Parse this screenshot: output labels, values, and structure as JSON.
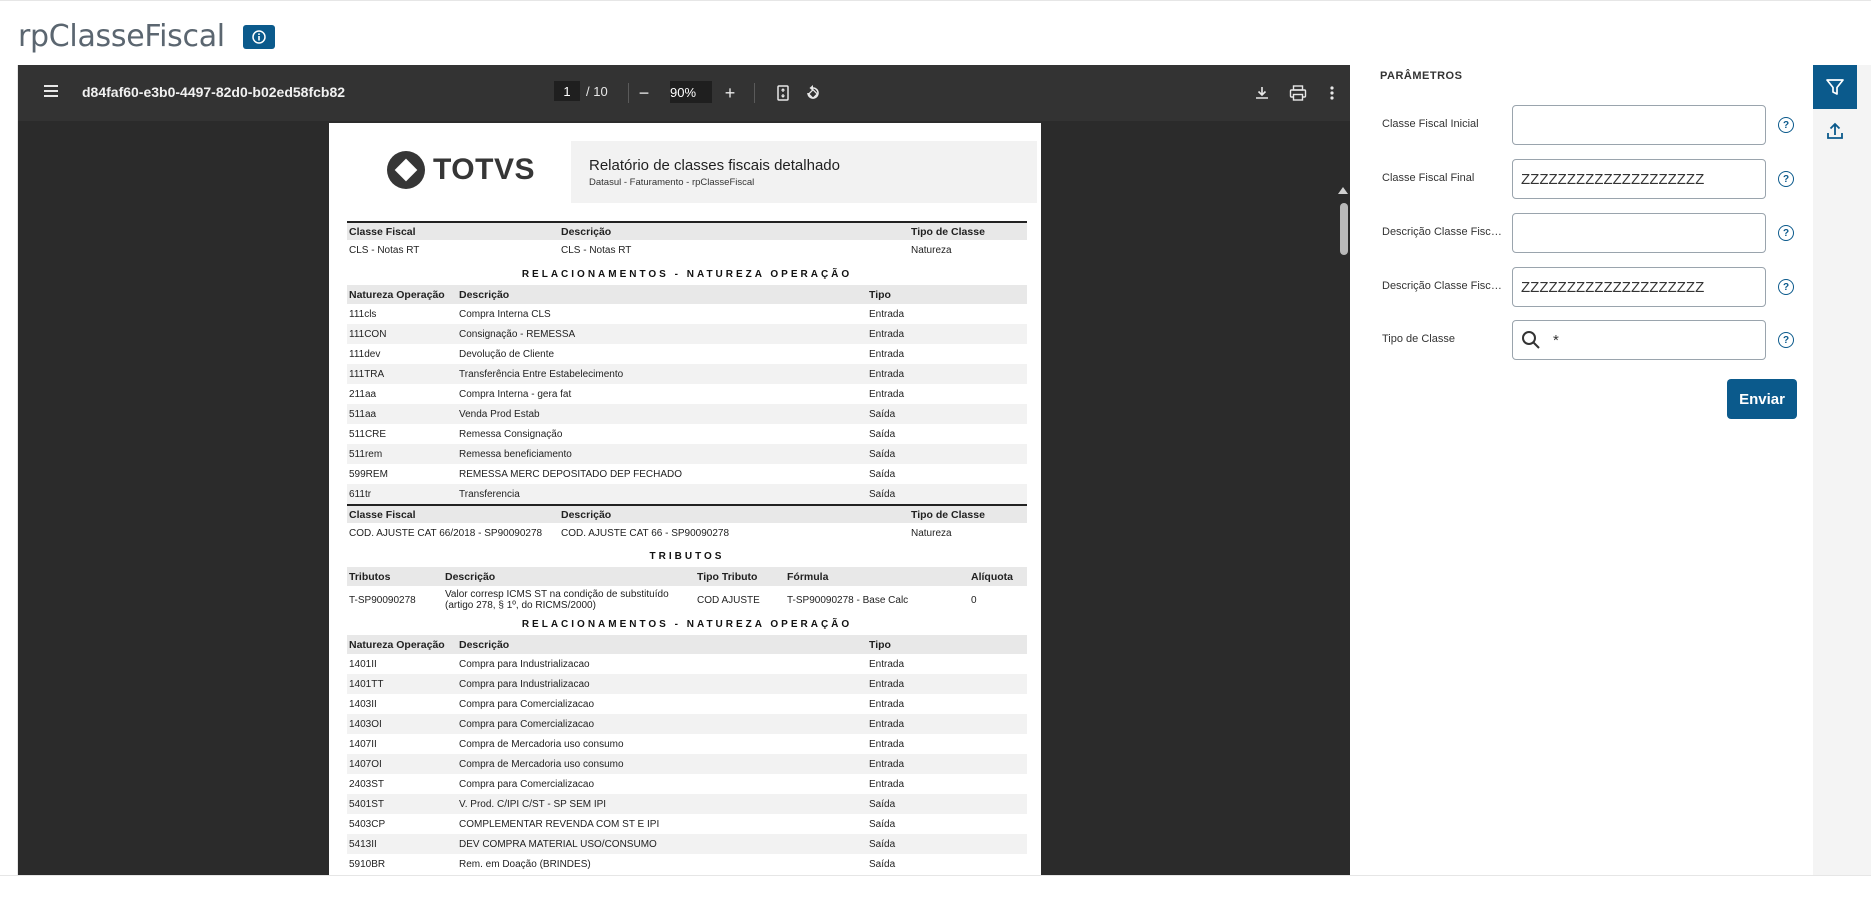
{
  "app": {
    "title": "rpClasseFiscal"
  },
  "viewer": {
    "file_name": "d84faf60-e3b0-4497-82d0-b02ed58fcb82",
    "current_page": "1",
    "page_total": "/ 10",
    "zoom": "90%",
    "zoom_out": "−",
    "zoom_in": "+"
  },
  "report": {
    "logo_text": "TOTVS",
    "title": "Relatório de classes fiscais detalhado",
    "subtitle": "Datasul - Faturamento - rpClasseFiscal",
    "class_headers": [
      "Classe Fiscal",
      "Descrição",
      "Tipo de Classe"
    ],
    "nat_headers": [
      "Natureza Operação",
      "Descrição",
      "Tipo"
    ],
    "trib_headers": [
      "Tributos",
      "Descrição",
      "Tipo Tributo",
      "Fórmula",
      "Alíquota"
    ],
    "section_nat": "RELACIONAMENTOS - NATUREZA OPERAÇÃO",
    "section_trib": "TRIBUTOS",
    "class1": [
      "CLS - Notas RT",
      "CLS - Notas RT",
      "Natureza"
    ],
    "nat1": [
      [
        "111cls",
        "Compra Interna CLS",
        "Entrada"
      ],
      [
        "111CON",
        "Consignação - REMESSA",
        "Entrada"
      ],
      [
        "111dev",
        "Devolução de Cliente",
        "Entrada"
      ],
      [
        "111TRA",
        "Transferência Entre Estabelecimento",
        "Entrada"
      ],
      [
        "211aa",
        "Compra Interna - gera fat",
        "Entrada"
      ],
      [
        "511aa",
        "Venda Prod Estab",
        "Saída"
      ],
      [
        "511CRE",
        "Remessa Consignação",
        "Saída"
      ],
      [
        "511rem",
        "Remessa beneficiamento",
        "Saída"
      ],
      [
        "599REM",
        "REMESSA MERC DEPOSITADO DEP FECHADO",
        "Saída"
      ],
      [
        "611tr",
        "Transferencia",
        "Saída"
      ]
    ],
    "class2": [
      "COD. AJUSTE CAT 66/2018 - SP90090278",
      "COD. AJUSTE CAT 66 - SP90090278",
      "Natureza"
    ],
    "trib1": [
      "T-SP90090278",
      "Valor corresp ICMS ST na condição de substituído (artigo 278, § 1º, do RICMS/2000)",
      "COD AJUSTE",
      "T-SP90090278 - Base Calc",
      "0"
    ],
    "nat2": [
      [
        "1401II",
        "Compra para Industrializacao",
        "Entrada"
      ],
      [
        "1401TT",
        "Compra para Industrializacao",
        "Entrada"
      ],
      [
        "1403II",
        "Compra para Comercializacao",
        "Entrada"
      ],
      [
        "1403OI",
        "Compra para Comercializacao",
        "Entrada"
      ],
      [
        "1407II",
        "Compra de Mercadoria uso consumo",
        "Entrada"
      ],
      [
        "1407OI",
        "Compra de Mercadoria uso consumo",
        "Entrada"
      ],
      [
        "2403ST",
        "Compra para Comercializacao",
        "Entrada"
      ],
      [
        "5401ST",
        "V. Prod. C/IPI C/ST - SP SEM IPI",
        "Saída"
      ],
      [
        "5403CP",
        "COMPLEMENTAR REVENDA COM ST E IPI",
        "Saída"
      ],
      [
        "5413II",
        "DEV COMPRA MATERIAL USO/CONSUMO",
        "Saída"
      ],
      [
        "5910BR",
        "Rem. em Doação (BRINDES)",
        "Saída"
      ]
    ]
  },
  "params": {
    "title": "PARÂMETROS",
    "fields": [
      {
        "label": "Classe Fiscal Inicial",
        "value": ""
      },
      {
        "label": "Classe Fiscal Final",
        "value": "ZZZZZZZZZZZZZZZZZZZZ"
      },
      {
        "label": "Descrição Classe Fisca...",
        "value": ""
      },
      {
        "label": "Descrição Classe Fisca...",
        "value": "ZZZZZZZZZZZZZZZZZZZZ"
      },
      {
        "label": "Tipo de Classe",
        "value": "*"
      }
    ],
    "help": "?",
    "send_label": "Enviar"
  },
  "colors": {
    "primary": "#0b5a8c",
    "toolbar": "#333333",
    "viewer_bg": "#2b2b2b"
  },
  "icons": [
    "info-icon",
    "menu-icon",
    "zoom-out-icon",
    "zoom-in-icon",
    "fit-page-icon",
    "rotate-icon",
    "download-icon",
    "print-icon",
    "more-icon",
    "search-icon",
    "help-icon",
    "filter-icon",
    "upload-icon"
  ]
}
